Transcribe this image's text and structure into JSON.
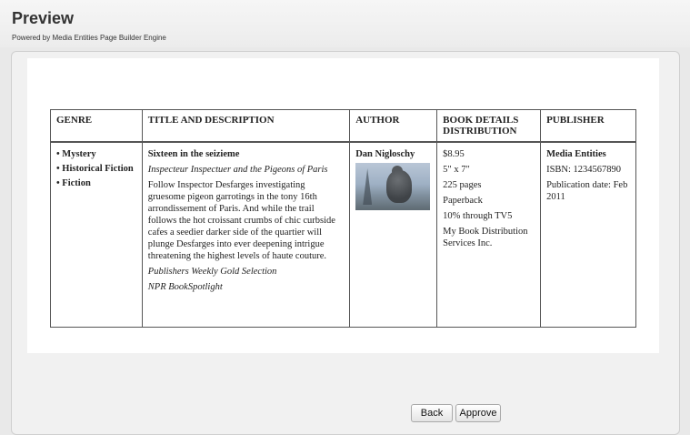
{
  "header": {
    "title": "Preview",
    "subtitle": "Powered by Media Entities Page Builder Engine"
  },
  "table": {
    "columns": [
      "GENRE",
      "TITLE AND DESCRIPTION",
      "AUTHOR",
      "BOOK DETAILS DISTRIBUTION",
      "PUBLISHER"
    ],
    "genres": [
      "• Mystery",
      "• Historical Fiction",
      "• Fiction"
    ],
    "book_title": "Sixteen in the seizieme",
    "book_subtitle": "Inspecteur Inspectuer and the Pigeons of Paris",
    "description": "Follow Inspector Desfarges investigating gruesome pigeon garrotings in the tony 16th arrondissement of Paris. And while the trail follows the hot croissant crumbs of chic curbside cafes a seedier darker side of the quartier will plunge Desfarges into ever deepening intrigue threatening the highest levels of haute couture.",
    "award_1": "Publishers Weekly Gold Selection",
    "award_2": "NPR BookSpotlight",
    "author": "Dan Nigloschy",
    "details": [
      "$8.95",
      "5\" x 7\"",
      "225 pages",
      "Paperback",
      "10% through TV5",
      "My Book Distribution Services Inc."
    ],
    "publisher_name": "Media Entities",
    "isbn": "ISBN: 1234567890",
    "pub_date": "Publication date: Feb 2011"
  },
  "buttons": {
    "back": "Back",
    "approve": "Approve"
  }
}
